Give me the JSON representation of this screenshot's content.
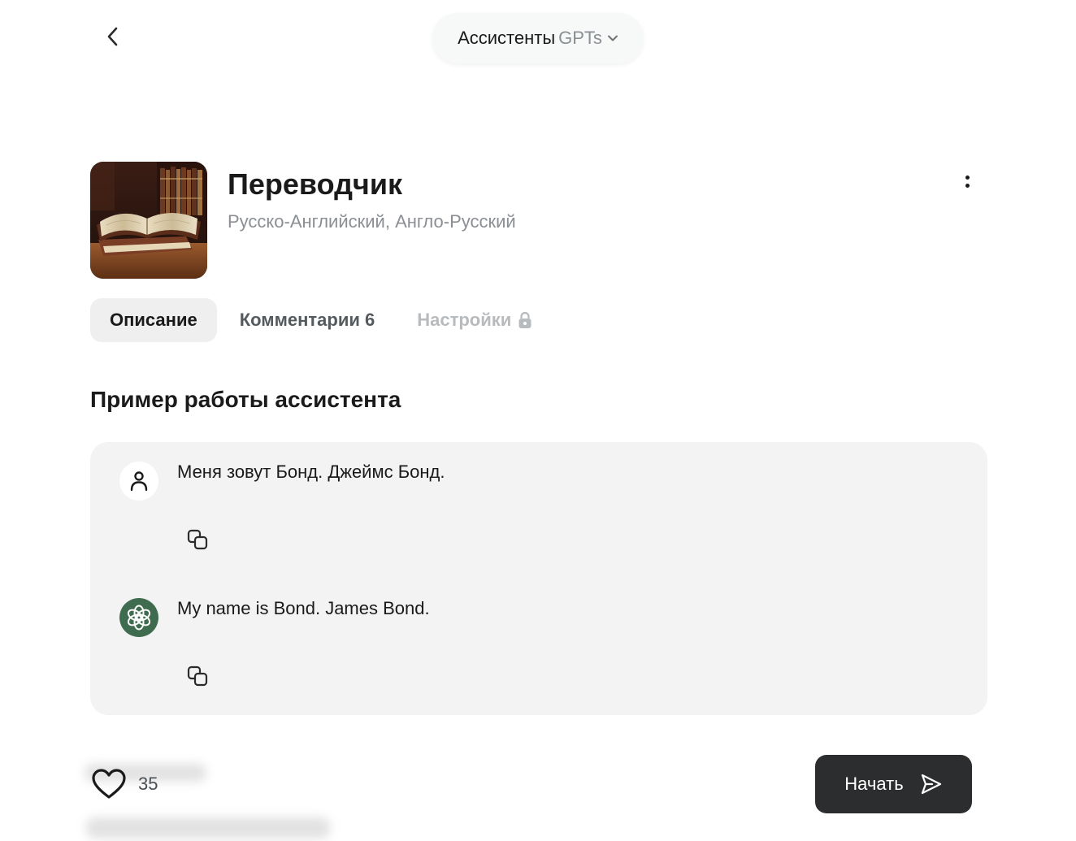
{
  "header": {
    "model_selector": {
      "label_main": "Ассистенты",
      "label_secondary": "GPTs"
    }
  },
  "assistant": {
    "title": "Переводчик",
    "subtitle": "Русско-Английский, Англо-Русский"
  },
  "tabs": [
    {
      "label": "Описание",
      "active": true
    },
    {
      "label": "Комментарии 6",
      "active": false
    },
    {
      "label": "Настройки",
      "active": false,
      "locked": true
    }
  ],
  "example": {
    "section_title": "Пример работы ассистента",
    "messages": [
      {
        "role": "user",
        "text": "Меня зовут Бонд. Джеймс Бонд."
      },
      {
        "role": "assistant",
        "text": "My name is Bond. James Bond."
      }
    ]
  },
  "footer": {
    "likes": "35",
    "start_label": "Начать"
  },
  "colors": {
    "start_button_bg": "#2c2d2e",
    "card_bg": "#f3f3f3",
    "bot_avatar_bg": "#3f6b4e"
  }
}
